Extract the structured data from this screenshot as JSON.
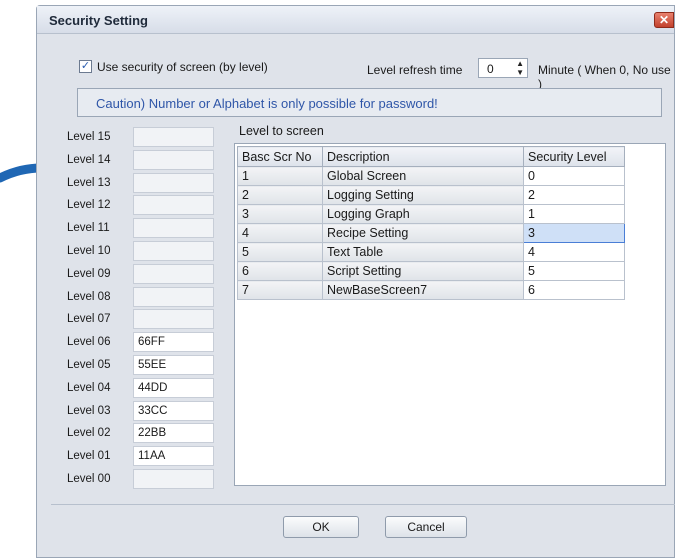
{
  "dialog": {
    "title": "Security Setting",
    "close_glyph": "✕"
  },
  "options": {
    "use_security_checked": true,
    "checkmark": "✓",
    "use_security_label": "Use security of screen (by level)",
    "refresh_label": "Level refresh time",
    "refresh_value": "0",
    "spin_up": "▲",
    "spin_down": "▼",
    "minute_label": "Minute ( When 0, No use )"
  },
  "caution": "Caution) Number or Alphabet is only possible for password!",
  "levels": [
    {
      "label": "Level 15",
      "value": ""
    },
    {
      "label": "Level 14",
      "value": ""
    },
    {
      "label": "Level 13",
      "value": ""
    },
    {
      "label": "Level 12",
      "value": ""
    },
    {
      "label": "Level 11",
      "value": ""
    },
    {
      "label": "Level 10",
      "value": ""
    },
    {
      "label": "Level 09",
      "value": ""
    },
    {
      "label": "Level 08",
      "value": ""
    },
    {
      "label": "Level 07",
      "value": ""
    },
    {
      "label": "Level 06",
      "value": "66FF"
    },
    {
      "label": "Level 05",
      "value": "55EE"
    },
    {
      "label": "Level 04",
      "value": "44DD"
    },
    {
      "label": "Level 03",
      "value": "33CC"
    },
    {
      "label": "Level 02",
      "value": "22BB"
    },
    {
      "label": "Level 01",
      "value": "11AA"
    },
    {
      "label": "Level 00",
      "value": ""
    }
  ],
  "screen_table": {
    "title": "Level to screen",
    "headers": [
      "Basc Scr No",
      "Description",
      "Security Level"
    ],
    "rows": [
      {
        "no": "1",
        "description": "Global Screen",
        "level": "0"
      },
      {
        "no": "2",
        "description": "Logging Setting",
        "level": "2"
      },
      {
        "no": "3",
        "description": "Logging Graph",
        "level": "1"
      },
      {
        "no": "4",
        "description": "Recipe Setting",
        "level": "3"
      },
      {
        "no": "5",
        "description": "Text Table",
        "level": "4"
      },
      {
        "no": "6",
        "description": "Script Setting",
        "level": "5"
      },
      {
        "no": "7",
        "description": "NewBaseScreen7",
        "level": "6"
      }
    ],
    "selected_row": 3
  },
  "buttons": {
    "ok": "OK",
    "cancel": "Cancel"
  },
  "colors": {
    "accent": "#2f56a8",
    "arrow": "#1f67b4"
  }
}
